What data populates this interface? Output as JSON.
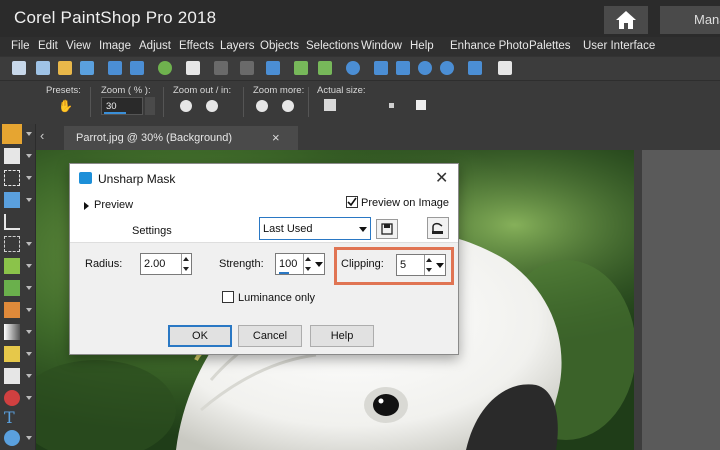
{
  "app": {
    "title": "Corel PaintShop Pro 2018",
    "tab_manage": "Manage"
  },
  "menu": [
    "File",
    "Edit",
    "View",
    "Image",
    "Adjust",
    "Effects",
    "Layers",
    "Objects",
    "Selections",
    "Window",
    "Help",
    "Enhance Photo",
    "Palettes",
    "User Interface"
  ],
  "options": {
    "presets_label": "Presets:",
    "zoom_label": "Zoom ( % ):",
    "zoom_value": "30",
    "zoom_outin_label": "Zoom out / in:",
    "zoom_more_label": "Zoom more:",
    "actual_size_label": "Actual size:"
  },
  "doc_tab": {
    "label": "Parrot.jpg @  30% (Background)",
    "close": "×"
  },
  "dialog": {
    "title": "Unsharp Mask",
    "close": "✕",
    "preview_label": "Preview",
    "preview_on_image_label": "Preview on Image",
    "settings_label": "Settings",
    "settings_value": "Last Used",
    "radius_label": "Radius:",
    "radius_value": "2.00",
    "strength_label": "Strength:",
    "strength_value": "100",
    "clipping_label": "Clipping:",
    "clipping_value": "5",
    "luminance_label": "Luminance only",
    "ok": "OK",
    "cancel": "Cancel",
    "help": "Help"
  },
  "colors": {
    "highlight": "#e07453",
    "accent": "#2a78c4",
    "icon_blue": "#1d8fd8"
  }
}
